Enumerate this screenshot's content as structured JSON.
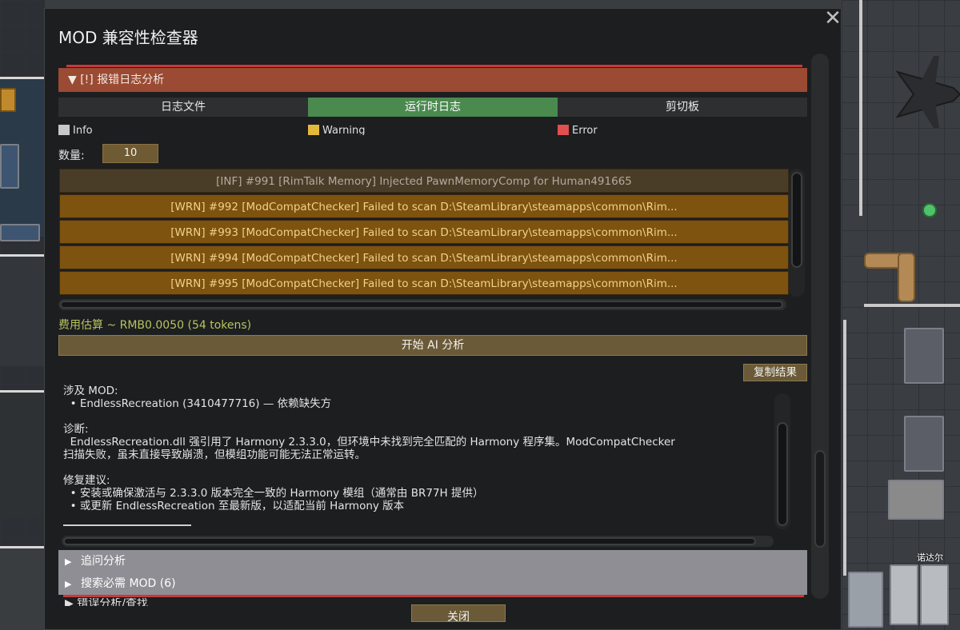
{
  "dialog": {
    "title": "MOD 兼容性检查器",
    "close_glyph": "✕"
  },
  "section": {
    "header": "▼ [!] 报错日志分析"
  },
  "tabs": [
    {
      "label": "日志文件",
      "active": false
    },
    {
      "label": "运行时日志",
      "active": true
    },
    {
      "label": "剪切板",
      "active": false
    }
  ],
  "legend": [
    {
      "label": "Info",
      "color": "#c8c8c8"
    },
    {
      "label": "Warning",
      "color": "#e3b93c"
    },
    {
      "label": "Error",
      "color": "#e05050"
    }
  ],
  "count": {
    "label": "数量:",
    "value": "10"
  },
  "logs": [
    {
      "level": "info",
      "text": "[INF] #991  [RimTalk Memory]  Injected PawnMemoryComp for Human491665"
    },
    {
      "level": "warn",
      "text": "[WRN] #992  [ModCompatChecker] Failed to scan D:\\SteamLibrary\\steamapps\\common\\Rim..."
    },
    {
      "level": "warn",
      "text": "[WRN] #993  [ModCompatChecker] Failed to scan D:\\SteamLibrary\\steamapps\\common\\Rim..."
    },
    {
      "level": "warn",
      "text": "[WRN] #994  [ModCompatChecker] Failed to scan D:\\SteamLibrary\\steamapps\\common\\Rim..."
    },
    {
      "level": "warn",
      "text": "[WRN] #995  [ModCompatChecker] Failed to scan D:\\SteamLibrary\\steamapps\\common\\Rim..."
    }
  ],
  "cost": {
    "text": "费用估算 ~ RMB0.0050 (54 tokens)"
  },
  "buttons": {
    "start_ai": "开始 AI 分析",
    "copy_result": "复制结果",
    "close": "关闭"
  },
  "result": {
    "mod_heading": "涉及 MOD:",
    "mod_line": "  • EndlessRecreation (3410477716) — 依赖缺失方",
    "diag_heading": "诊断:",
    "diag_line1": "  EndlessRecreation.dll 强引用了 Harmony 2.3.3.0，但环境中未找到完全匹配的 Harmony 程序集。ModCompatChecker",
    "diag_line2": "扫描失败，虽未直接导致崩溃，但模组功能可能无法正常运转。",
    "fix_heading": "修复建议:",
    "fix_line1": "  • 安装或确保激活与 2.3.3.0 版本完全一致的 Harmony 模组（通常由 BR77H 提供）",
    "fix_line2": "  • 或更新 EndlessRecreation 至最新版，以适配当前 Harmony 版本"
  },
  "collapsibles": [
    {
      "label": "追问分析",
      "arrow": "▶"
    },
    {
      "label": "搜索必需 MOD (6)",
      "arrow": "▶"
    }
  ],
  "partial_row": "▶  错误分析/查找",
  "background": {
    "pawn_name": "诺达尔"
  }
}
